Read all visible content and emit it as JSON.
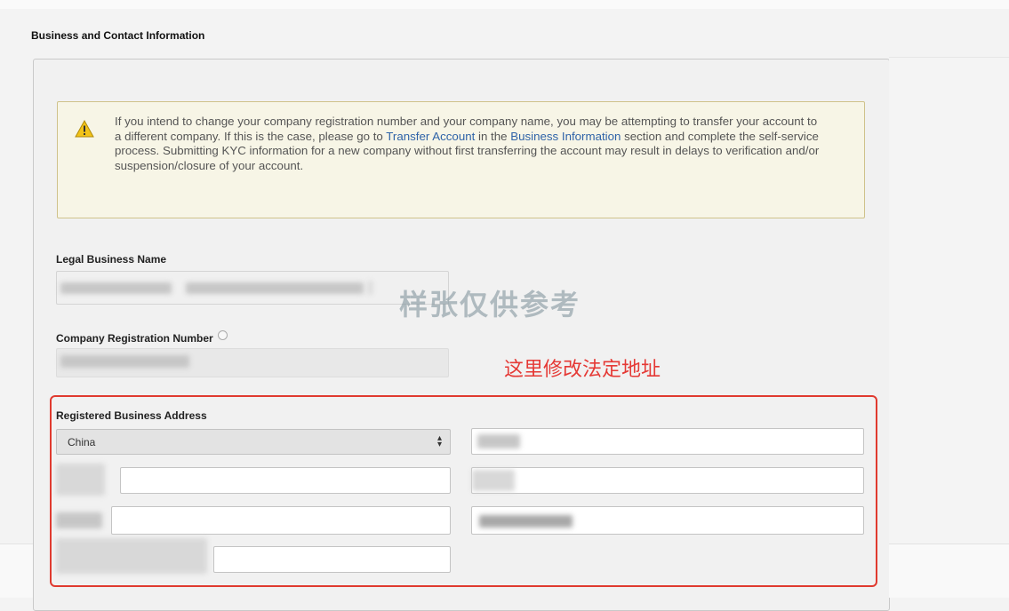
{
  "section": {
    "title": "Business and Contact Information"
  },
  "warning": {
    "icon": "warning-triangle-icon",
    "text_before": "If you intend to change your company registration number and your company name, you may be attempting to transfer your account to a different company. If this is the case, please go to ",
    "link_transfer": "Transfer Account",
    "text_middle": " in the ",
    "link_business": "Business Information",
    "text_after": " section and complete the self-service process. Submitting KYC information for a new company without first transferring the account may result in delays to verification and/or suspension/closure of your account."
  },
  "fields": {
    "legal_name_label": "Legal Business Name",
    "company_reg_label": "Company Registration Number",
    "company_reg_help_icon": "help-circle-icon",
    "address_label": "Registered Business Address",
    "country_value": "China",
    "country_select_icon": "select-arrows-icon"
  },
  "overlay": {
    "watermark": "样张仅供参考",
    "annotation": "这里修改法定地址",
    "highlight_color": "#e03a2f",
    "annotation_color": "#e53935"
  },
  "colors": {
    "link": "#2f63a8",
    "warning_border": "#cfc28b",
    "warning_bg": "#f7f5e6"
  }
}
